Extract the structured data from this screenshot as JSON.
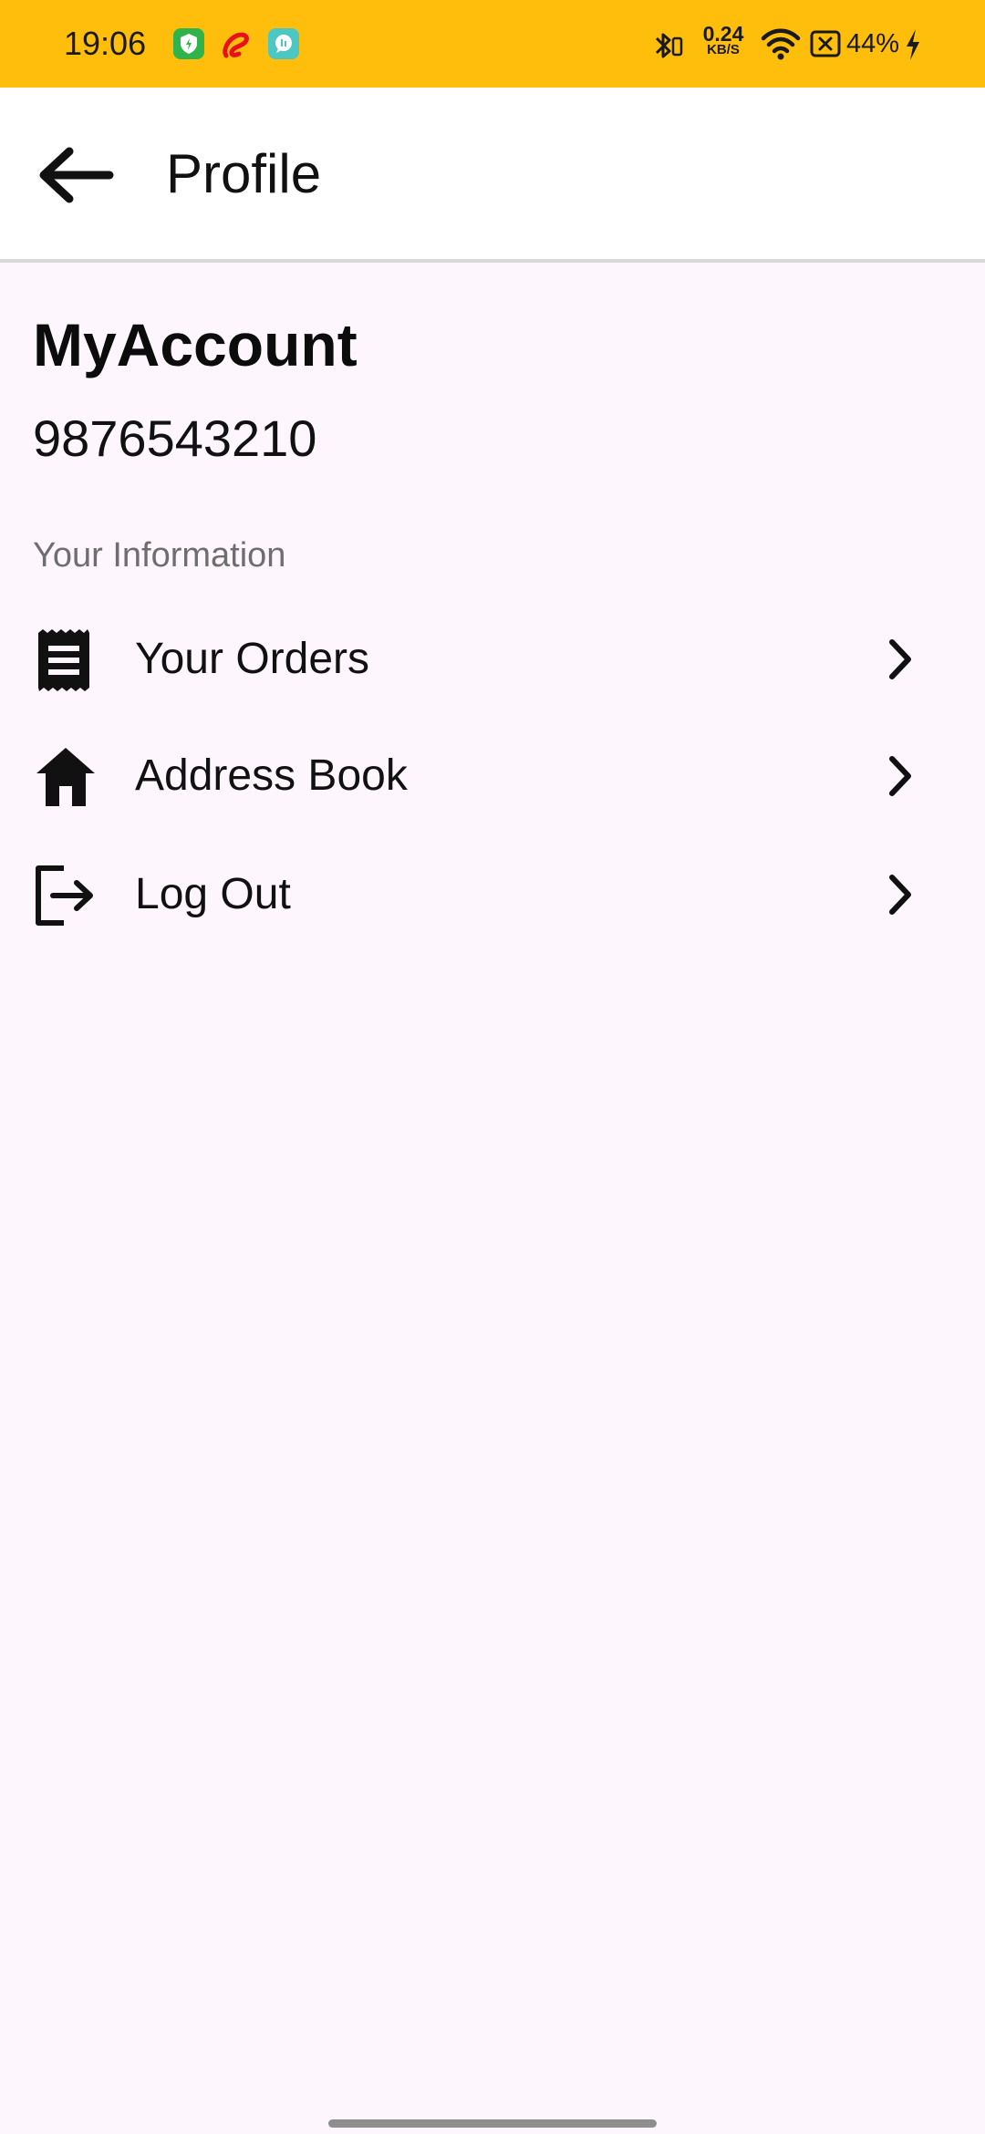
{
  "status_bar": {
    "time": "19:06",
    "net_speed_value": "0.24",
    "net_speed_unit": "KB/S",
    "battery": "44%",
    "icons": [
      "shield-app-icon",
      "airtel-app-icon",
      "chat-app-icon",
      "bluetooth-icon",
      "wifi-icon",
      "sim-off-icon",
      "charging-icon"
    ]
  },
  "app_bar": {
    "title": "Profile",
    "back_icon": "arrow-left-icon"
  },
  "account": {
    "name": "MyAccount",
    "phone": "9876543210"
  },
  "section": {
    "label": "Your Information"
  },
  "menu": {
    "items": [
      {
        "label": "Your Orders",
        "icon": "receipt-icon"
      },
      {
        "label": "Address Book",
        "icon": "home-icon"
      },
      {
        "label": "Log Out",
        "icon": "logout-icon"
      }
    ]
  },
  "colors": {
    "status_bar_bg": "#FFBE0B",
    "page_bg": "#FDF7FD",
    "app_bar_bg": "#FFFFFF",
    "secondary_text": "#6E6E6E"
  }
}
